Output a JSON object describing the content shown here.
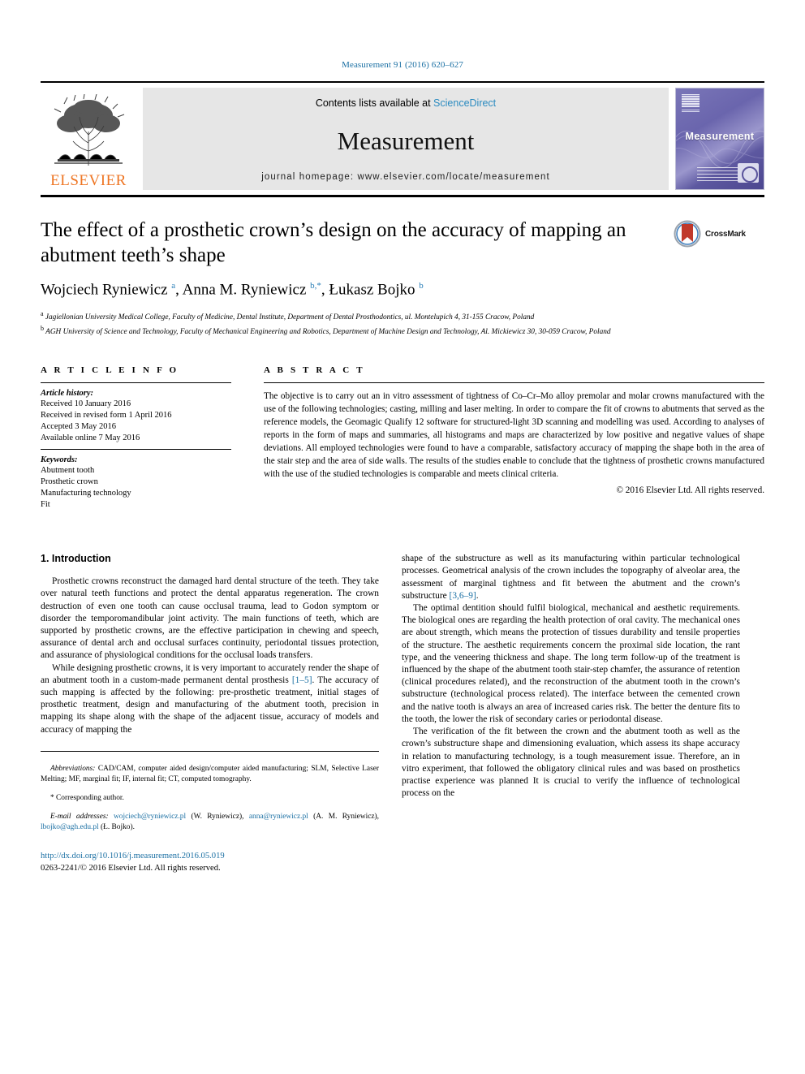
{
  "running_head": "Measurement 91 (2016) 620–627",
  "masthead": {
    "publisher": "ELSEVIER",
    "contents_prefix": "Contents lists available at ",
    "contents_link": "ScienceDirect",
    "journal_title": "Measurement",
    "homepage": "journal homepage: www.elsevier.com/locate/measurement",
    "cover_title": "Measurement"
  },
  "article": {
    "title": "The effect of a prosthetic crown’s design on the accuracy of mapping an abutment teeth’s shape",
    "crossmark_label": "CrossMark",
    "authors_html": "Wojciech Ryniewicz <sup>a</sup>, Anna M. Ryniewicz <sup>b,</sup><sup>*</sup>, Łukasz Bojko <sup>b</sup>",
    "affiliation_a": "Jagiellonian University Medical College, Faculty of Medicine, Dental Institute, Department of Dental Prosthodontics, ul. Montelupich 4, 31-155 Cracow, Poland",
    "affiliation_b": "AGH University of Science and Technology, Faculty of Mechanical Engineering and Robotics, Department of Machine Design and Technology, Al. Mickiewicz 30, 30-059 Cracow, Poland"
  },
  "info": {
    "heading": "A R T I C L E   I N F O",
    "history_label": "Article history:",
    "history": [
      "Received 10 January 2016",
      "Received in revised form 1 April 2016",
      "Accepted 3 May 2016",
      "Available online 7 May 2016"
    ],
    "keywords_label": "Keywords:",
    "keywords": [
      "Abutment tooth",
      "Prosthetic crown",
      "Manufacturing technology",
      "Fit"
    ]
  },
  "abstract": {
    "heading": "A B S T R A C T",
    "text": "The objective is to carry out an in vitro assessment of tightness of Co–Cr–Mo alloy premolar and molar crowns manufactured with the use of the following technologies; casting, milling and laser melting. In order to compare the fit of crowns to abutments that served as the reference models, the Geomagic Qualify 12 software for structured-light 3D scanning and modelling was used. According to analyses of reports in the form of maps and summaries, all histograms and maps are characterized by low positive and negative values of shape deviations. All employed technologies were found to have a comparable, satisfactory accuracy of mapping the shape both in the area of the stair step and the area of side walls. The results of the studies enable to conclude that the tightness of prosthetic crowns manufactured with the use of the studied technologies is comparable and meets clinical criteria.",
    "copyright": "© 2016 Elsevier Ltd. All rights reserved."
  },
  "introduction": {
    "section_number_title": "1. Introduction",
    "left_paragraphs": [
      "Prosthetic crowns reconstruct the damaged hard dental structure of the teeth. They take over natural teeth functions and protect the dental apparatus regeneration. The crown destruction of even one tooth can cause occlusal trauma, lead to Godon symptom or disorder the temporomandibular joint activity. The main functions of teeth, which are supported by prosthetic crowns, are the effective participation in chewing and speech, assurance of dental arch and occlusal surfaces continuity, periodontal tissues protection, and assurance of physiological conditions for the occlusal loads transfers.",
      "While designing prosthetic crowns, it is very important to accurately render the shape of an abutment tooth in a custom-made permanent dental prosthesis [1–5]. The accuracy of such mapping is affected by the following: pre-prosthetic treatment, initial stages of prosthetic treatment, design and manufacturing of the abutment tooth, precision in mapping its shape along with the shape of the adjacent tissue, accuracy of models and accuracy of mapping the"
    ],
    "left_ref_1": "[1–5]",
    "right_paragraphs": [
      "shape of the substructure as well as its manufacturing within particular technological processes. Geometrical analysis of the crown includes the topography of alveolar area, the assessment of marginal tightness and fit between the abutment and the crown’s substructure [3,6–9].",
      "The optimal dentition should fulfil biological, mechanical and aesthetic requirements. The biological ones are regarding the health protection of oral cavity. The mechanical ones are about strength, which means the protection of tissues durability and tensile properties of the structure. The aesthetic requirements concern the proximal side location, the rant type, and the veneering thickness and shape. The long term follow-up of the treatment is influenced by the shape of the abutment tooth stair-step chamfer, the assurance of retention (clinical procedures related), and the reconstruction of the abutment tooth in the crown’s substructure (technological process related). The interface between the cemented crown and the native tooth is always an area of increased caries risk. The better the denture fits to the tooth, the lower the risk of secondary caries or periodontal disease.",
      "The verification of the fit between the crown and the abutment tooth as well as the crown’s substructure shape and dimensioning evaluation, which assess its shape accuracy in relation to manufacturing technology, is a tough measurement issue. Therefore, an in vitro experiment, that followed the obligatory clinical rules and was based on prosthetics practise experience was planned It is crucial to verify the influence of technological process on the"
    ],
    "right_ref_1": "[3,6–9]"
  },
  "footnotes": {
    "abbreviations_label": "Abbreviations:",
    "abbreviations_text": "CAD/CAM, computer aided design/computer aided manufacturing; SLM, Selective Laser Melting; MF, marginal fit; IF, internal fit; CT, computed tomography.",
    "corresponding": "* Corresponding author.",
    "email_label": "E-mail addresses:",
    "email_1": "wojciech@ryniewicz.pl",
    "email_1_owner": "(W. Ryniewicz), ",
    "email_2": "anna@ryniewicz.pl",
    "email_2_owner": "(A. M. Ryniewicz), ",
    "email_3": "lbojko@agh.edu.pl",
    "email_3_owner": "(Ł. Bojko).",
    "doi_url": "http://dx.doi.org/10.1016/j.measurement.2016.05.019",
    "issn_line": "0263-2241/© 2016 Elsevier Ltd. All rights reserved."
  },
  "colors": {
    "link": "#1a6fa3",
    "elsevier_orange": "#ee7523",
    "sciencedirect_blue": "#2b8bc0",
    "cover_purple": "#6a65ad"
  }
}
